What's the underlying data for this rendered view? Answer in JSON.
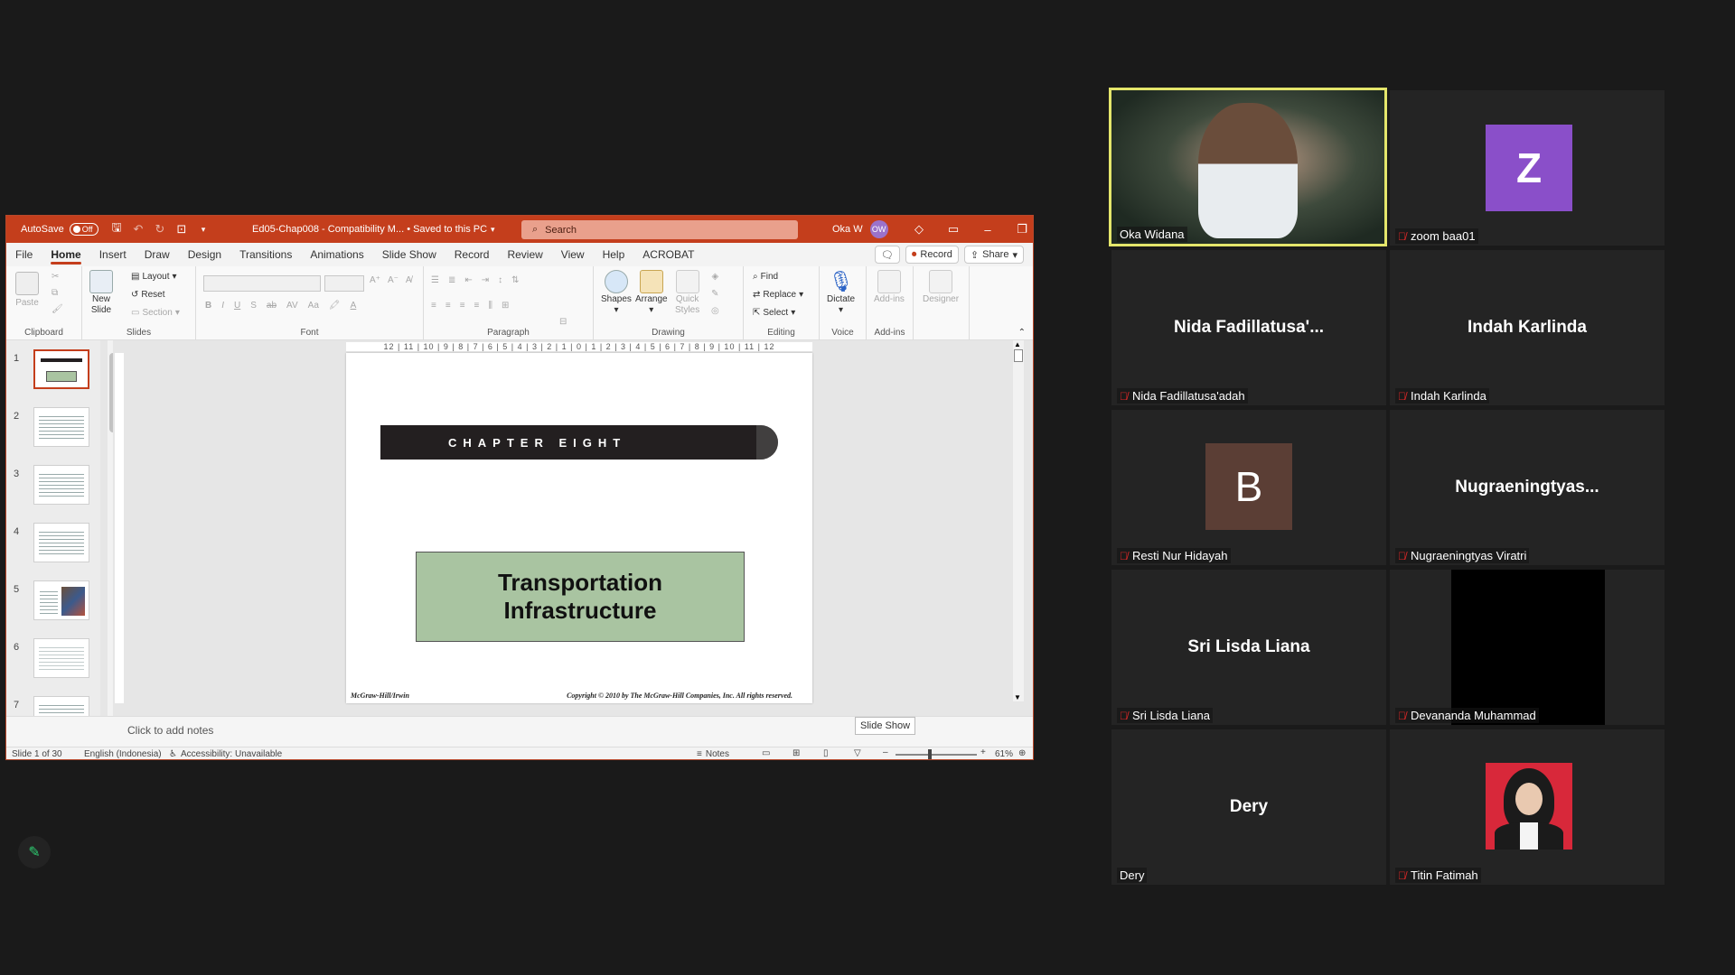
{
  "powerpoint": {
    "autosave_label": "AutoSave",
    "autosave_state": "Off",
    "doc_title": "Ed05-Chap008  -  Compatibility M...  •  Saved to this PC",
    "search_placeholder": "Search",
    "user_name": "Oka W",
    "user_initials": "OW",
    "tabs": [
      "File",
      "Home",
      "Insert",
      "Draw",
      "Design",
      "Transitions",
      "Animations",
      "Slide Show",
      "Record",
      "Review",
      "View",
      "Help",
      "ACROBAT"
    ],
    "record_label": "Record",
    "share_label": "Share",
    "ribbon": {
      "paste": "Paste",
      "new_slide_1": "New",
      "new_slide_2": "Slide",
      "layout": "Layout",
      "reset": "Reset",
      "section": "Section",
      "shapes": "Shapes",
      "arrange": "Arrange",
      "quick_styles_1": "Quick",
      "quick_styles_2": "Styles",
      "find": "Find",
      "replace": "Replace",
      "select": "Select",
      "dictate": "Dictate",
      "addins": "Add-ins",
      "designer": "Designer",
      "groups": {
        "clipboard": "Clipboard",
        "slides": "Slides",
        "font": "Font",
        "paragraph": "Paragraph",
        "drawing": "Drawing",
        "editing": "Editing",
        "voice": "Voice",
        "addins": "Add-ins"
      }
    },
    "ruler": "12 | 11 | 10 | 9 | 8 | 7 | 6 | 5 | 4 | 3 | 2 | 1 | 0 | 1 | 2 | 3 | 4 | 5 | 6 | 7 | 8 | 9 | 10 | 11 | 12",
    "thumbnails": [
      "1",
      "2",
      "3",
      "4",
      "5",
      "6",
      "7"
    ],
    "slide": {
      "chapter": "CHAPTER EIGHT",
      "title_line1": "Transportation",
      "title_line2": "Infrastructure",
      "footer_left": "McGraw-Hill/Irwin",
      "footer_right": "Copyright © 2010 by The McGraw-Hill Companies, Inc. All rights reserved."
    },
    "notes_placeholder": "Click to add notes",
    "tooltip": "Slide Show",
    "status": {
      "slide_count": "Slide 1 of 30",
      "language": "English (Indonesia)",
      "accessibility": "Accessibility: Unavailable",
      "notes": "Notes",
      "zoom": "61%"
    },
    "colors": {
      "accent": "#c43e1c",
      "slide_title_fill": "#a9c4a1"
    }
  },
  "participants": [
    {
      "name": "Oka Widana",
      "type": "video",
      "muted": false,
      "active_speaker": true
    },
    {
      "name": "zoom baa01",
      "type": "letter",
      "letter": "Z",
      "color": "#8a4fc9",
      "muted": true
    },
    {
      "name": "Nida Fadillatusa'adah",
      "display": "Nida  Fadillatusa'...",
      "type": "name",
      "muted": true
    },
    {
      "name": "Indah Karlinda",
      "display": "Indah Karlinda",
      "type": "name",
      "muted": true
    },
    {
      "name": "Resti Nur Hidayah",
      "type": "letter",
      "letter": "B",
      "color": "#5b3e35",
      "muted": true
    },
    {
      "name": "Nugraeningtyas Viratri",
      "display": "Nugraeningtyas...",
      "type": "name",
      "muted": true
    },
    {
      "name": "Sri Lisda Liana",
      "display": "Sri Lisda Liana",
      "type": "name",
      "muted": true
    },
    {
      "name": "Devananda Muhammad",
      "type": "video-off",
      "muted": true
    },
    {
      "name": "Dery",
      "display": "Dery",
      "type": "name",
      "muted": false
    },
    {
      "name": "Titin Fatimah",
      "type": "photo",
      "muted": true
    }
  ]
}
